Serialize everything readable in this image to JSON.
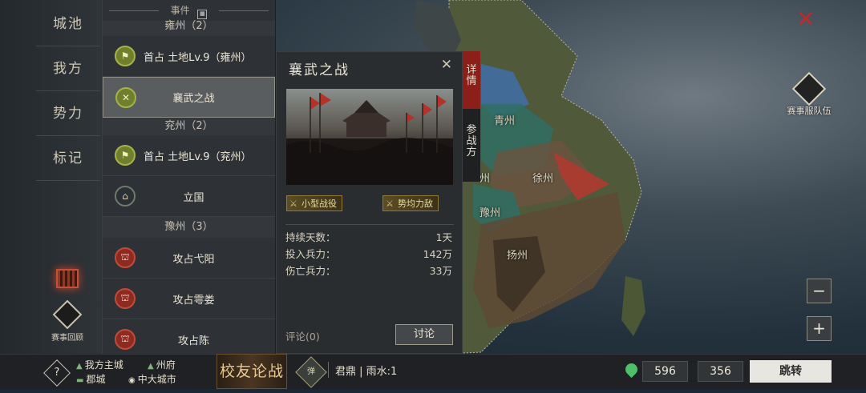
{
  "nav": {
    "items": [
      "城池",
      "我方",
      "势力",
      "标记"
    ]
  },
  "events": {
    "header": "事件",
    "regions": [
      {
        "name": "雍州（2）",
        "items": [
          {
            "label": "首占 土地Lv.9（雍州）",
            "icon": "flag-icon",
            "color": "green"
          },
          {
            "label": "襄武之战",
            "icon": "crossed-swords-icon",
            "color": "green",
            "selected": true
          }
        ]
      },
      {
        "name": "兖州（2）",
        "items": [
          {
            "label": "首占 土地Lv.9（兖州）",
            "icon": "flag-icon",
            "color": "green"
          },
          {
            "label": "立国",
            "icon": "palace-icon",
            "color": "dark"
          }
        ]
      },
      {
        "name": "豫州（3）",
        "items": [
          {
            "label": "攻占弋阳",
            "icon": "city-gate-icon",
            "color": "red"
          },
          {
            "label": "攻占雩娄",
            "icon": "city-gate-icon",
            "color": "red"
          },
          {
            "label": "攻占陈",
            "icon": "city-gate-icon",
            "color": "red"
          }
        ]
      }
    ]
  },
  "detail": {
    "title": "襄武之战",
    "tags": [
      "小型战役",
      "势均力敌"
    ],
    "stats": [
      {
        "label": "持续天数：",
        "value": "1天"
      },
      {
        "label": "投入兵力：",
        "value": "142万"
      },
      {
        "label": "伤亡兵力：",
        "value": "33万"
      }
    ],
    "comments": "评论(0)",
    "discuss": "讨论",
    "tabs": [
      "详情",
      "参战方"
    ]
  },
  "map": {
    "labels": [
      "青州",
      "徐州",
      "豫州",
      "扬州",
      "州"
    ],
    "team_button": "赛事服队伍",
    "season_review": "赛事回顾",
    "zoom_out": "−",
    "zoom_in": "+",
    "colors": {
      "blue": "#3f6fa8",
      "teal": "#2f6f64",
      "red": "#b03a30",
      "brown": "#5e4a35",
      "olive": "#4f5a2e"
    }
  },
  "bottom": {
    "help": "?",
    "legend": [
      {
        "label": "我方主城",
        "icon": "home-city-icon"
      },
      {
        "label": "州府",
        "icon": "capital-icon"
      },
      {
        "label": "郡城",
        "icon": "county-city-icon"
      },
      {
        "label": "中大城市",
        "icon": "large-city-icon"
      }
    ],
    "banner": "校友论战",
    "season_badge": "弹",
    "status": "君鼎 | 雨水:1",
    "x": "596",
    "y": "356",
    "jump": "跳转"
  }
}
